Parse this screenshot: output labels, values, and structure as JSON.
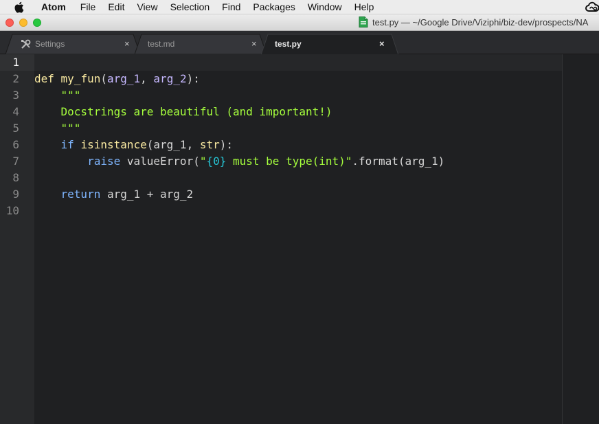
{
  "menubar": {
    "app_name": "Atom",
    "items": [
      "File",
      "Edit",
      "View",
      "Selection",
      "Find",
      "Packages",
      "Window",
      "Help"
    ]
  },
  "window": {
    "title": "test.py — ~/Google Drive/Viziphi/biz-dev/prospects/NA"
  },
  "tabs": [
    {
      "label": "Settings",
      "icon": "tools-icon",
      "close": "×",
      "active": false
    },
    {
      "label": "test.md",
      "close": "×",
      "active": false
    },
    {
      "label": "test.py",
      "close": "×",
      "active": true
    }
  ],
  "editor": {
    "current_line": 1,
    "line_numbers": [
      "1",
      "2",
      "3",
      "4",
      "5",
      "6",
      "7",
      "8",
      "9",
      "10"
    ],
    "lines": [
      {
        "tokens": []
      },
      {
        "tokens": [
          {
            "t": "def",
            "c": "kw-def"
          },
          {
            "t": " ",
            "c": "plain"
          },
          {
            "t": "my_fun",
            "c": "fn"
          },
          {
            "t": "(",
            "c": "punc"
          },
          {
            "t": "arg_1",
            "c": "param"
          },
          {
            "t": ", ",
            "c": "punc"
          },
          {
            "t": "arg_2",
            "c": "param"
          },
          {
            "t": "):",
            "c": "punc"
          }
        ]
      },
      {
        "tokens": [
          {
            "t": "    ",
            "c": "plain"
          },
          {
            "t": "\"\"\"",
            "c": "doc"
          }
        ]
      },
      {
        "tokens": [
          {
            "t": "    ",
            "c": "plain"
          },
          {
            "t": "Docstrings are beautiful (and important!)",
            "c": "doc"
          }
        ]
      },
      {
        "tokens": [
          {
            "t": "    ",
            "c": "plain"
          },
          {
            "t": "\"\"\"",
            "c": "doc"
          }
        ]
      },
      {
        "tokens": [
          {
            "t": "    ",
            "c": "plain"
          },
          {
            "t": "if",
            "c": "kw"
          },
          {
            "t": " ",
            "c": "plain"
          },
          {
            "t": "isinstance",
            "c": "fn"
          },
          {
            "t": "(arg_1, ",
            "c": "plain"
          },
          {
            "t": "str",
            "c": "fn"
          },
          {
            "t": "):",
            "c": "plain"
          }
        ]
      },
      {
        "tokens": [
          {
            "t": "        ",
            "c": "plain"
          },
          {
            "t": "raise",
            "c": "kw"
          },
          {
            "t": " valueError(",
            "c": "plain"
          },
          {
            "t": "\"",
            "c": "str"
          },
          {
            "t": "{0}",
            "c": "fmt"
          },
          {
            "t": " must be type(int)\"",
            "c": "str"
          },
          {
            "t": ".format(arg_1)",
            "c": "plain"
          }
        ]
      },
      {
        "tokens": []
      },
      {
        "tokens": [
          {
            "t": "    ",
            "c": "plain"
          },
          {
            "t": "return",
            "c": "kw"
          },
          {
            "t": " arg_1 + arg_2",
            "c": "plain"
          }
        ]
      },
      {
        "tokens": []
      }
    ]
  },
  "colors": {
    "background": "#1f2022",
    "gutter": "#28292b",
    "keyword": "#7fb6ff",
    "function": "#f8e8a0",
    "parameter": "#c6b8ff",
    "string": "#a6ff3d",
    "format_placeholder": "#26c6d6"
  }
}
